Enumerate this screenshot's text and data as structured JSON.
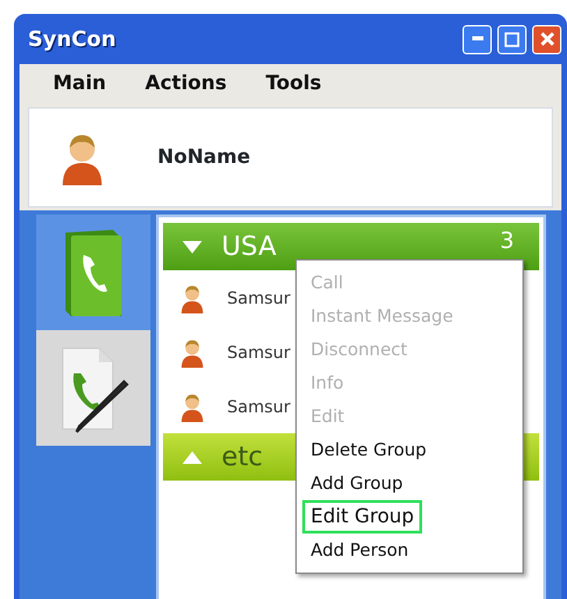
{
  "window": {
    "title": "SynCon"
  },
  "menu": [
    {
      "label": "Main"
    },
    {
      "label": "Actions"
    },
    {
      "label": "Tools"
    }
  ],
  "profile": {
    "name": "NoName"
  },
  "side_tabs": [
    {
      "kind": "phonebook",
      "selected": true
    },
    {
      "kind": "call-log",
      "selected": false
    }
  ],
  "groups": [
    {
      "name": "USA",
      "count": "3",
      "expanded": true,
      "contacts": [
        "Samsur",
        "Samsur",
        "Samsur"
      ]
    },
    {
      "name": "etc",
      "expanded": false
    }
  ],
  "context_menu": [
    {
      "label": "Call",
      "disabled": true,
      "selected": false
    },
    {
      "label": "Instant Message",
      "disabled": true,
      "selected": false
    },
    {
      "label": "Disconnect",
      "disabled": true,
      "selected": false
    },
    {
      "label": "Info",
      "disabled": true,
      "selected": false
    },
    {
      "label": "Edit",
      "disabled": true,
      "selected": false
    },
    {
      "label": "Delete Group",
      "disabled": false,
      "selected": false
    },
    {
      "label": "Add Group",
      "disabled": false,
      "selected": false
    },
    {
      "label": "Edit Group",
      "disabled": false,
      "selected": true
    },
    {
      "label": "Add Person",
      "disabled": false,
      "selected": false
    }
  ]
}
